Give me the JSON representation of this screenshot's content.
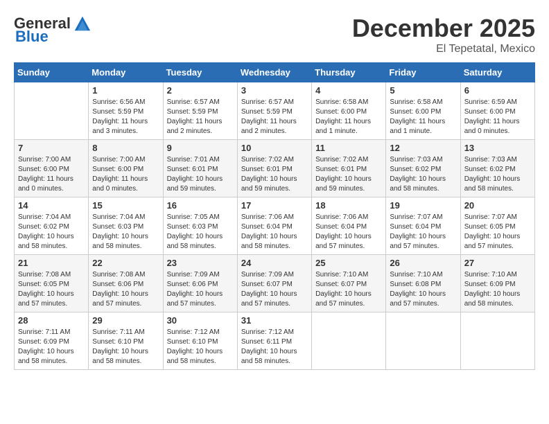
{
  "header": {
    "logo_general": "General",
    "logo_blue": "Blue",
    "month": "December 2025",
    "location": "El Tepetatal, Mexico"
  },
  "days_of_week": [
    "Sunday",
    "Monday",
    "Tuesday",
    "Wednesday",
    "Thursday",
    "Friday",
    "Saturday"
  ],
  "weeks": [
    [
      {
        "day": "",
        "info": ""
      },
      {
        "day": "1",
        "info": "Sunrise: 6:56 AM\nSunset: 5:59 PM\nDaylight: 11 hours\nand 3 minutes."
      },
      {
        "day": "2",
        "info": "Sunrise: 6:57 AM\nSunset: 5:59 PM\nDaylight: 11 hours\nand 2 minutes."
      },
      {
        "day": "3",
        "info": "Sunrise: 6:57 AM\nSunset: 5:59 PM\nDaylight: 11 hours\nand 2 minutes."
      },
      {
        "day": "4",
        "info": "Sunrise: 6:58 AM\nSunset: 6:00 PM\nDaylight: 11 hours\nand 1 minute."
      },
      {
        "day": "5",
        "info": "Sunrise: 6:58 AM\nSunset: 6:00 PM\nDaylight: 11 hours\nand 1 minute."
      },
      {
        "day": "6",
        "info": "Sunrise: 6:59 AM\nSunset: 6:00 PM\nDaylight: 11 hours\nand 0 minutes."
      }
    ],
    [
      {
        "day": "7",
        "info": "Sunrise: 7:00 AM\nSunset: 6:00 PM\nDaylight: 11 hours\nand 0 minutes."
      },
      {
        "day": "8",
        "info": "Sunrise: 7:00 AM\nSunset: 6:00 PM\nDaylight: 11 hours\nand 0 minutes."
      },
      {
        "day": "9",
        "info": "Sunrise: 7:01 AM\nSunset: 6:01 PM\nDaylight: 10 hours\nand 59 minutes."
      },
      {
        "day": "10",
        "info": "Sunrise: 7:02 AM\nSunset: 6:01 PM\nDaylight: 10 hours\nand 59 minutes."
      },
      {
        "day": "11",
        "info": "Sunrise: 7:02 AM\nSunset: 6:01 PM\nDaylight: 10 hours\nand 59 minutes."
      },
      {
        "day": "12",
        "info": "Sunrise: 7:03 AM\nSunset: 6:02 PM\nDaylight: 10 hours\nand 58 minutes."
      },
      {
        "day": "13",
        "info": "Sunrise: 7:03 AM\nSunset: 6:02 PM\nDaylight: 10 hours\nand 58 minutes."
      }
    ],
    [
      {
        "day": "14",
        "info": "Sunrise: 7:04 AM\nSunset: 6:02 PM\nDaylight: 10 hours\nand 58 minutes."
      },
      {
        "day": "15",
        "info": "Sunrise: 7:04 AM\nSunset: 6:03 PM\nDaylight: 10 hours\nand 58 minutes."
      },
      {
        "day": "16",
        "info": "Sunrise: 7:05 AM\nSunset: 6:03 PM\nDaylight: 10 hours\nand 58 minutes."
      },
      {
        "day": "17",
        "info": "Sunrise: 7:06 AM\nSunset: 6:04 PM\nDaylight: 10 hours\nand 58 minutes."
      },
      {
        "day": "18",
        "info": "Sunrise: 7:06 AM\nSunset: 6:04 PM\nDaylight: 10 hours\nand 57 minutes."
      },
      {
        "day": "19",
        "info": "Sunrise: 7:07 AM\nSunset: 6:04 PM\nDaylight: 10 hours\nand 57 minutes."
      },
      {
        "day": "20",
        "info": "Sunrise: 7:07 AM\nSunset: 6:05 PM\nDaylight: 10 hours\nand 57 minutes."
      }
    ],
    [
      {
        "day": "21",
        "info": "Sunrise: 7:08 AM\nSunset: 6:05 PM\nDaylight: 10 hours\nand 57 minutes."
      },
      {
        "day": "22",
        "info": "Sunrise: 7:08 AM\nSunset: 6:06 PM\nDaylight: 10 hours\nand 57 minutes."
      },
      {
        "day": "23",
        "info": "Sunrise: 7:09 AM\nSunset: 6:06 PM\nDaylight: 10 hours\nand 57 minutes."
      },
      {
        "day": "24",
        "info": "Sunrise: 7:09 AM\nSunset: 6:07 PM\nDaylight: 10 hours\nand 57 minutes."
      },
      {
        "day": "25",
        "info": "Sunrise: 7:10 AM\nSunset: 6:07 PM\nDaylight: 10 hours\nand 57 minutes."
      },
      {
        "day": "26",
        "info": "Sunrise: 7:10 AM\nSunset: 6:08 PM\nDaylight: 10 hours\nand 57 minutes."
      },
      {
        "day": "27",
        "info": "Sunrise: 7:10 AM\nSunset: 6:09 PM\nDaylight: 10 hours\nand 58 minutes."
      }
    ],
    [
      {
        "day": "28",
        "info": "Sunrise: 7:11 AM\nSunset: 6:09 PM\nDaylight: 10 hours\nand 58 minutes."
      },
      {
        "day": "29",
        "info": "Sunrise: 7:11 AM\nSunset: 6:10 PM\nDaylight: 10 hours\nand 58 minutes."
      },
      {
        "day": "30",
        "info": "Sunrise: 7:12 AM\nSunset: 6:10 PM\nDaylight: 10 hours\nand 58 minutes."
      },
      {
        "day": "31",
        "info": "Sunrise: 7:12 AM\nSunset: 6:11 PM\nDaylight: 10 hours\nand 58 minutes."
      },
      {
        "day": "",
        "info": ""
      },
      {
        "day": "",
        "info": ""
      },
      {
        "day": "",
        "info": ""
      }
    ]
  ]
}
